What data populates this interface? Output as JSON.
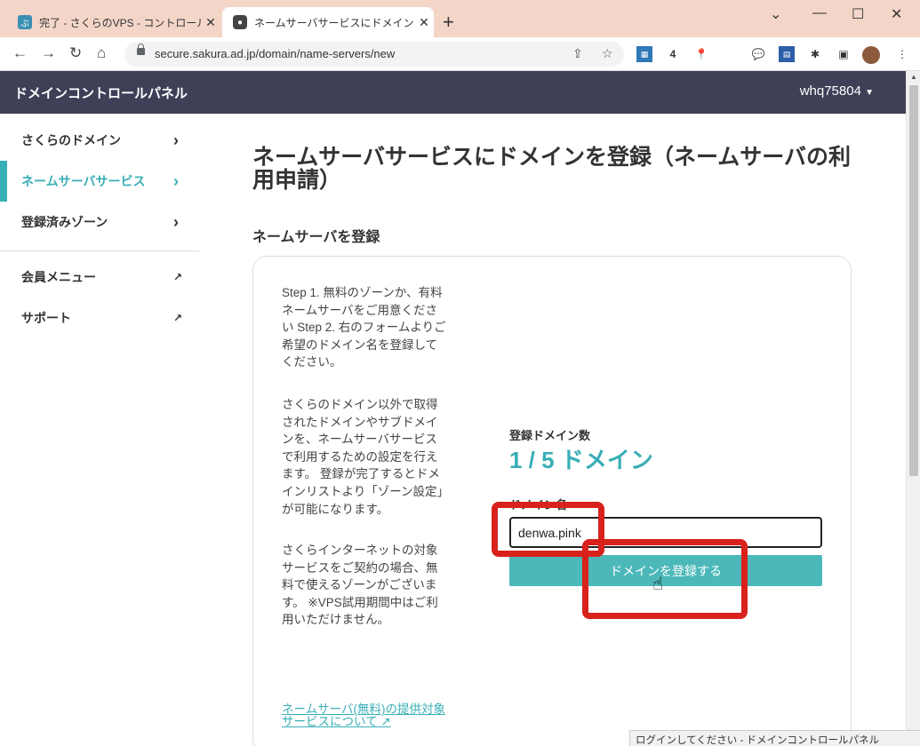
{
  "browser": {
    "tabs": [
      {
        "title": "完了 - さくらのVPS - コントロールパネ",
        "favicon": "sakura-vps-favicon",
        "active": false
      },
      {
        "title": "ネームサーバサービスにドメインを登録",
        "favicon": "sakura-domain-favicon",
        "active": true
      }
    ],
    "new_tab": "+",
    "url": "secure.sakura.ad.jp/domain/name-servers/new",
    "extension_text": "4"
  },
  "header": {
    "title": "ドメインコントロールパネル",
    "user": "whq75804"
  },
  "sidebar": {
    "items": [
      {
        "label": "さくらのドメイン",
        "icon": "chevron-right-icon"
      },
      {
        "label": "ネームサーバサービス",
        "icon": "chevron-right-icon",
        "active": true
      },
      {
        "label": "登録済みゾーン",
        "icon": "chevron-right-icon"
      },
      {
        "label": "会員メニュー",
        "icon": "external-link-icon"
      },
      {
        "label": "サポート",
        "icon": "external-link-icon"
      }
    ]
  },
  "main": {
    "title": "ネームサーバサービスにドメインを登録（ネームサーバの利用申請）",
    "section": "ネームサーバを登録",
    "description": {
      "p1": "Step 1. 無料のゾーンか、有料ネームサーバをご用意ください Step 2. 右のフォームよりご希望のドメイン名を登録してください。",
      "p2": "さくらのドメイン以外で取得されたドメインやサブドメインを、ネームサーバサービスで利用するための設定を行えます。 登録が完了するとドメインリストより「ゾーン設定」が可能になります。",
      "p3": "さくらインターネットの対象サービスをご契約の場合、無料で使えるゾーンがございます。 ※VPS試用期間中はご利用いただけません。",
      "link": "ネームサーバ(無料)の提供対象サービスについて"
    },
    "form": {
      "count_label": "登録ドメイン数",
      "count_value": "1 / 5 ドメイン",
      "domain_label": "ドメイン名",
      "domain_value": "denwa.pink",
      "submit_label": "ドメインを登録する"
    }
  },
  "status_bar": "ログインしてください - ドメインコントロールパネル",
  "colors": {
    "accent": "#38aeb6",
    "header_bg": "#3d4057",
    "highlight": "#d9221c",
    "button": "#4cb8b9"
  }
}
